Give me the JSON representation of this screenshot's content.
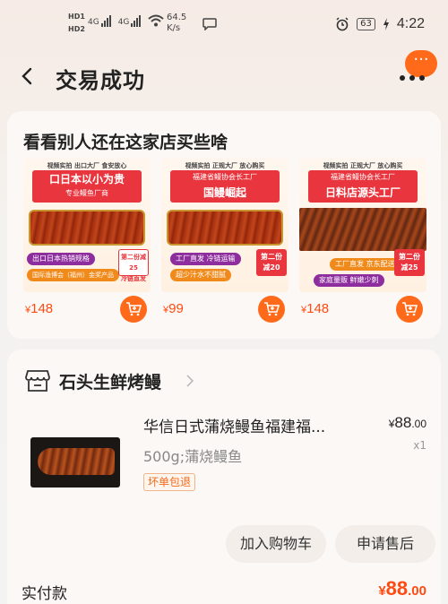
{
  "status_bar": {
    "hd1": "HD1",
    "hd2": "HD2",
    "net1": "4G",
    "net2": "4G",
    "speed_value": "64.5",
    "speed_unit": "K/s",
    "battery": "63",
    "time": "4:22"
  },
  "header": {
    "title": "交易成功",
    "bubble": "···"
  },
  "recommend": {
    "title": "看看别人还在这家店买些啥",
    "products": [
      {
        "top_line": "视频实拍 出口大厂 食安放心",
        "banner_main": "口日本以小为贵",
        "banner_sub": "专业鳗鱼厂商",
        "pill1": "出口日本热销规格",
        "pill2": "国际渔博会（福州）金奖产品",
        "tag": "第二份减25",
        "tag_sub": "冷链直发",
        "currency": "¥",
        "price": "148"
      },
      {
        "top_line": "视频实拍 正规大厂 放心购买",
        "banner_main": "国鳗崛起",
        "banner_sub": "福建省鳗协会长工厂",
        "pill1": "工厂直发 冷链运输",
        "pill2": "超少汁水不甜腻",
        "tag": "第二份",
        "tag_sub": "减20",
        "currency": "¥",
        "price": "99"
      },
      {
        "top_line": "视频实拍 正规大厂 放心购买",
        "banner_main": "日料店源头工厂",
        "banner_sub": "福建省鳗协会长工厂",
        "pill1": "工厂直发 京东配送",
        "pill2": "家庭量贩 鲜嫩少刺",
        "tag": "第二份",
        "tag_sub": "减25",
        "currency": "¥",
        "price": "148"
      }
    ]
  },
  "order": {
    "store_name": "石头生鲜烤鳗",
    "item_title": "华信日式蒲烧鳗鱼福建福...",
    "item_currency": "¥",
    "item_price_int": "88",
    "item_price_dec": ".00",
    "item_qty": "x1",
    "item_spec": "500g;蒲烧鳗鱼",
    "item_badge": "坏单包退",
    "btn_add_cart": "加入购物车",
    "btn_refund": "申请售后",
    "paid_label": "实付款",
    "paid_currency": "¥",
    "paid_int": "88",
    "paid_dec": ".00"
  },
  "colors": {
    "accent": "#ff6a1a",
    "price": "#ff4b11",
    "banner_red": "#e8353e"
  }
}
